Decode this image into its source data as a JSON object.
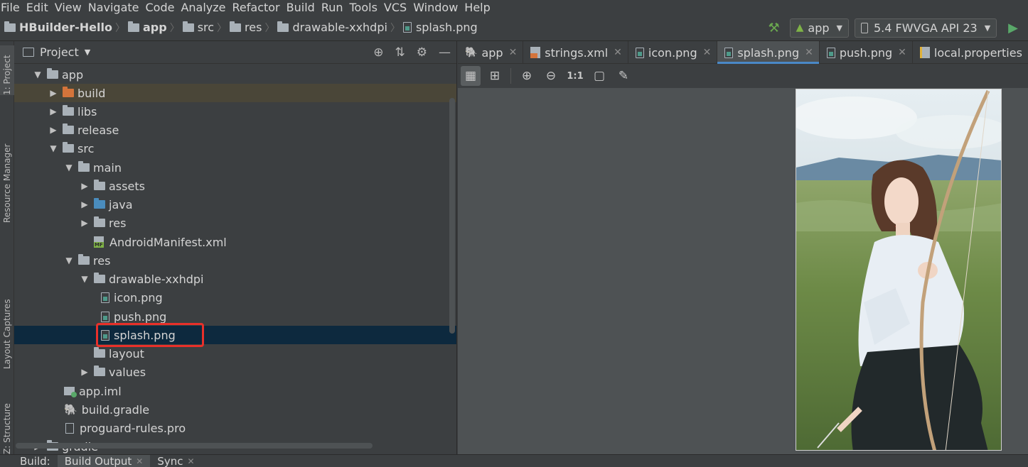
{
  "menu": [
    "File",
    "Edit",
    "View",
    "Navigate",
    "Code",
    "Analyze",
    "Refactor",
    "Build",
    "Run",
    "Tools",
    "VCS",
    "Window",
    "Help"
  ],
  "breadcrumb": {
    "project": "HBuilder-Hello",
    "items": [
      "app",
      "src",
      "res",
      "drawable-xxhdpi",
      "splash.png"
    ]
  },
  "toolbar": {
    "run_config": "app",
    "device": "5.4  FWVGA API 23"
  },
  "stripe": {
    "project": "1: Project",
    "resource_manager": "Resource Manager",
    "layout_captures": "Layout Captures",
    "structure": "Z: Structure"
  },
  "project_panel": {
    "title": "Project",
    "tree": [
      {
        "label": "app"
      },
      {
        "label": "build"
      },
      {
        "label": "libs"
      },
      {
        "label": "release"
      },
      {
        "label": "src"
      },
      {
        "label": "main"
      },
      {
        "label": "assets"
      },
      {
        "label": "java"
      },
      {
        "label": "res"
      },
      {
        "label": "AndroidManifest.xml"
      },
      {
        "label": "res"
      },
      {
        "label": "drawable-xxhdpi"
      },
      {
        "label": "icon.png"
      },
      {
        "label": "push.png"
      },
      {
        "label": "splash.png"
      },
      {
        "label": "layout"
      },
      {
        "label": "values"
      },
      {
        "label": "app.iml"
      },
      {
        "label": "build.gradle"
      },
      {
        "label": "proguard-rules.pro"
      },
      {
        "label": "gradle"
      }
    ]
  },
  "editor": {
    "tabs": [
      {
        "label": "app"
      },
      {
        "label": "strings.xml"
      },
      {
        "label": "icon.png"
      },
      {
        "label": "splash.png"
      },
      {
        "label": "push.png"
      },
      {
        "label": "local.properties"
      }
    ],
    "zoom_label": "1:1"
  },
  "bottom": {
    "build": "Build:",
    "build_output": "Build Output",
    "sync": "Sync"
  },
  "colors": {
    "bg": "#3c3f41",
    "editor_bg": "#4e5254",
    "selection": "#0d293e",
    "highlight_box": "#e8302a",
    "accent": "#4a88c7"
  }
}
